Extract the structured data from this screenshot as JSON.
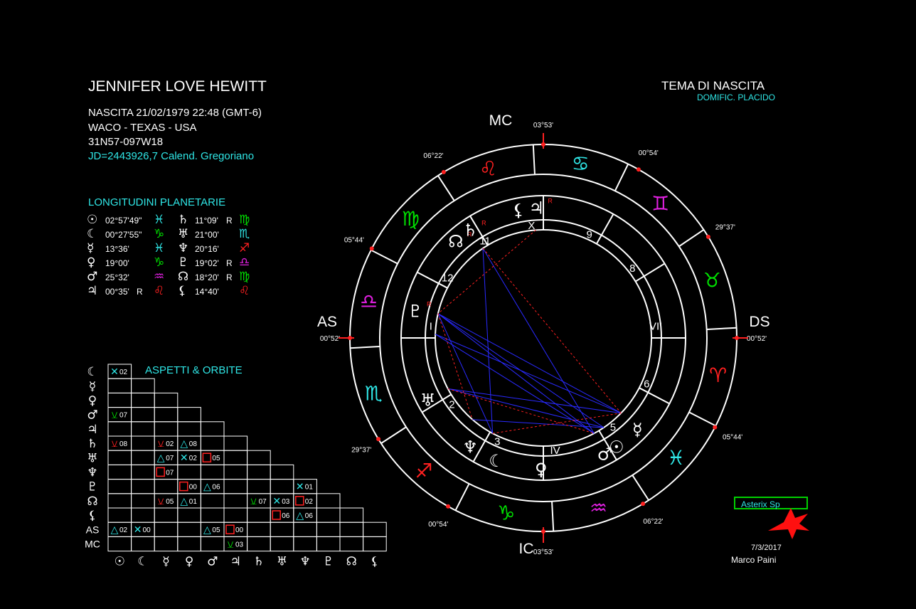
{
  "header": {
    "name": "JENNIFER LOVE HEWITT",
    "birth": "NASCITA 21/02/1979 22:48 (GMT-6)",
    "place": "WACO - TEXAS - USA",
    "coords": "31N57-097W18",
    "jd": "JD=2443926,7  Calend. Gregoriano"
  },
  "chart_title": {
    "title": "TEMA DI NASCITA",
    "subtitle": "DOMIFIC. PLACIDO"
  },
  "longitudes": {
    "title": "LONGITUDINI PLANETARIE",
    "rows": [
      {
        "g1": "☉",
        "v1": "02°57'49\"",
        "r1": "",
        "s1": "♓",
        "c1": "#2fe6e6",
        "g2": "♄",
        "v2": "11°09'",
        "r2": "R",
        "s2": "♍",
        "c2": "#00e000"
      },
      {
        "g1": "☾",
        "v1": "00°27'55\"",
        "r1": "",
        "s1": "♑",
        "c1": "#00e000",
        "g2": "♅",
        "v2": "21°00'",
        "r2": "",
        "s2": "♏",
        "c2": "#2fe6e6"
      },
      {
        "g1": "☿",
        "v1": "13°36'",
        "r1": "",
        "s1": "♓",
        "c1": "#2fe6e6",
        "g2": "♆",
        "v2": "20°16'",
        "r2": "",
        "s2": "♐",
        "c2": "#ff2020"
      },
      {
        "g1": "♀",
        "v1": "19°00'",
        "r1": "",
        "s1": "♑",
        "c1": "#00e000",
        "g2": "♇",
        "v2": "19°02'",
        "r2": "R",
        "s2": "♎",
        "c2": "#e020e0"
      },
      {
        "g1": "♂",
        "v1": "25°32'",
        "r1": "",
        "s1": "♒",
        "c1": "#e020e0",
        "g2": "☊",
        "v2": "18°20'",
        "r2": "R",
        "s2": "♍",
        "c2": "#00e000"
      },
      {
        "g1": "♃",
        "v1": "00°35'",
        "r1": "R",
        "s1": "♌",
        "c1": "#ff2020",
        "g2": "⚸",
        "v2": "14°40'",
        "r2": "",
        "s2": "♌",
        "c2": "#ff2020"
      }
    ]
  },
  "aspects": {
    "title": "ASPETTI  &  ORBITE",
    "row_labels": [
      "☾",
      "☿",
      "♀",
      "♂",
      "♃",
      "♄",
      "♅",
      "♆",
      "♇",
      "☊",
      "⚸",
      "AS",
      "MC"
    ],
    "col_labels": [
      "☉",
      "☾",
      "☿",
      "♀",
      "♂",
      "♃",
      "♄",
      "♅",
      "♆",
      "♇",
      "☊",
      "⚸"
    ],
    "entries": [
      {
        "row": 0,
        "col": 0,
        "sym": "✕",
        "color": "#2fe6e6",
        "orb": "02"
      },
      {
        "row": 3,
        "col": 0,
        "sym": "⚺",
        "color": "#00e000",
        "orb": "07"
      },
      {
        "row": 5,
        "col": 0,
        "sym": "⚺",
        "color": "#ff2020",
        "orb": "08"
      },
      {
        "row": 5,
        "col": 2,
        "sym": "⚺",
        "color": "#ff2020",
        "orb": "02"
      },
      {
        "row": 5,
        "col": 3,
        "sym": "△",
        "color": "#2fe6e6",
        "orb": "08"
      },
      {
        "row": 6,
        "col": 2,
        "sym": "△",
        "color": "#2fe6e6",
        "orb": "07"
      },
      {
        "row": 6,
        "col": 3,
        "sym": "✕",
        "color": "#2fe6e6",
        "orb": "02"
      },
      {
        "row": 6,
        "col": 4,
        "sym": "□",
        "color": "#ff2020",
        "orb": "05"
      },
      {
        "row": 7,
        "col": 2,
        "sym": "□",
        "color": "#ff2020",
        "orb": "07"
      },
      {
        "row": 8,
        "col": 3,
        "sym": "□",
        "color": "#ff2020",
        "orb": "00"
      },
      {
        "row": 8,
        "col": 4,
        "sym": "△",
        "color": "#2fe6e6",
        "orb": "06"
      },
      {
        "row": 8,
        "col": 8,
        "sym": "✕",
        "color": "#2fe6e6",
        "orb": "01"
      },
      {
        "row": 9,
        "col": 2,
        "sym": "⚺",
        "color": "#ff2020",
        "orb": "05"
      },
      {
        "row": 9,
        "col": 3,
        "sym": "△",
        "color": "#2fe6e6",
        "orb": "01"
      },
      {
        "row": 9,
        "col": 6,
        "sym": "⚺",
        "color": "#00e000",
        "orb": "07"
      },
      {
        "row": 9,
        "col": 7,
        "sym": "✕",
        "color": "#2fe6e6",
        "orb": "03"
      },
      {
        "row": 9,
        "col": 8,
        "sym": "□",
        "color": "#ff2020",
        "orb": "02"
      },
      {
        "row": 10,
        "col": 7,
        "sym": "□",
        "color": "#ff2020",
        "orb": "06"
      },
      {
        "row": 10,
        "col": 8,
        "sym": "△",
        "color": "#2fe6e6",
        "orb": "06"
      },
      {
        "row": 11,
        "col": 0,
        "sym": "△",
        "color": "#2fe6e6",
        "orb": "02"
      },
      {
        "row": 11,
        "col": 1,
        "sym": "✕",
        "color": "#2fe6e6",
        "orb": "00"
      },
      {
        "row": 11,
        "col": 4,
        "sym": "△",
        "color": "#2fe6e6",
        "orb": "05"
      },
      {
        "row": 11,
        "col": 5,
        "sym": "□",
        "color": "#ff2020",
        "orb": "00"
      },
      {
        "row": 12,
        "col": 5,
        "sym": "⚺",
        "color": "#00e000",
        "orb": "03"
      }
    ]
  },
  "wheel": {
    "angle_labels": {
      "mc": "MC",
      "ic": "IC",
      "as": "AS",
      "ds": "DS"
    },
    "cusp_degrees": [
      {
        "label": "03°53'",
        "deg": 90
      },
      {
        "label": "00°54'",
        "deg": 60.5
      },
      {
        "label": "29°37'",
        "deg": 31.5
      },
      {
        "label": "00°52'",
        "deg": 0
      },
      {
        "label": "05°44'",
        "deg": -27.5
      },
      {
        "label": "06°22'",
        "deg": -59
      },
      {
        "label": "03°53'",
        "deg": -90
      },
      {
        "label": "00°54'",
        "deg": -119.5
      },
      {
        "label": "29°37'",
        "deg": -148.5
      },
      {
        "label": "00°52'",
        "deg": 180
      },
      {
        "label": "05°44'",
        "deg": 152.5
      },
      {
        "label": "06°22'",
        "deg": 121
      }
    ],
    "sign_boundaries": [
      93,
      64,
      34,
      3,
      -27,
      -57,
      -87,
      -117,
      -147,
      -177,
      153,
      123
    ],
    "signs": [
      {
        "glyph": "♋",
        "deg": 78,
        "color": "#2fe6e6"
      },
      {
        "glyph": "♊",
        "deg": 49,
        "color": "#e020e0"
      },
      {
        "glyph": "♉",
        "deg": 19,
        "color": "#00e000"
      },
      {
        "glyph": "♈",
        "deg": -12,
        "color": "#ff2020"
      },
      {
        "glyph": "♓",
        "deg": -42,
        "color": "#2fe6e6"
      },
      {
        "glyph": "♒",
        "deg": -72,
        "color": "#e020e0"
      },
      {
        "glyph": "♑",
        "deg": -102,
        "color": "#00e000"
      },
      {
        "glyph": "♐",
        "deg": -132,
        "color": "#ff2020"
      },
      {
        "glyph": "♏",
        "deg": -162,
        "color": "#2fe6e6"
      },
      {
        "glyph": "♎",
        "deg": 168,
        "color": "#e020e0"
      },
      {
        "glyph": "♍",
        "deg": 138,
        "color": "#00e000"
      },
      {
        "glyph": "♌",
        "deg": 108,
        "color": "#ff2020"
      }
    ],
    "houses": [
      {
        "label": "X",
        "deg": 96,
        "cusp": 90
      },
      {
        "label": "9",
        "deg": 66,
        "cusp": 60.5
      },
      {
        "label": "8",
        "deg": 38,
        "cusp": 31.5
      },
      {
        "label": "VII",
        "deg": 6,
        "cusp": 0
      },
      {
        "label": "6",
        "deg": -24,
        "cusp": -27.5
      },
      {
        "label": "5",
        "deg": -52,
        "cusp": -59
      },
      {
        "label": "IV",
        "deg": -84,
        "cusp": -90
      },
      {
        "label": "3",
        "deg": -114,
        "cusp": -119.5
      },
      {
        "label": "2",
        "deg": -144,
        "cusp": -148.5
      },
      {
        "label": "I",
        "deg": 174,
        "cusp": 180
      },
      {
        "label": "12",
        "deg": 148,
        "cusp": 152.5
      },
      {
        "label": "11",
        "deg": 121,
        "cusp": 121
      }
    ],
    "planets": [
      {
        "glyph": "⚸",
        "deg": 101,
        "retro": ""
      },
      {
        "glyph": "♃",
        "deg": 93,
        "retro": "R"
      },
      {
        "glyph": "☊",
        "deg": 132,
        "retro": "R"
      },
      {
        "glyph": "♄",
        "deg": 124,
        "retro": "R"
      },
      {
        "glyph": "♇",
        "deg": 168,
        "retro": "R"
      },
      {
        "glyph": "♅",
        "deg": -152,
        "retro": ""
      },
      {
        "glyph": "♆",
        "deg": -124,
        "retro": ""
      },
      {
        "glyph": "☾",
        "deg": -111,
        "retro": ""
      },
      {
        "glyph": "♀",
        "deg": -91,
        "retro": ""
      },
      {
        "glyph": "♂",
        "deg": -62,
        "retro": ""
      },
      {
        "glyph": "☉",
        "deg": -56,
        "retro": ""
      },
      {
        "glyph": "☿",
        "deg": -44,
        "retro": ""
      }
    ],
    "aspect_lines": [
      {
        "a": 167,
        "b": -44,
        "color": "#2a2aff",
        "style": "solid"
      },
      {
        "a": 167,
        "b": -56,
        "color": "#2a2aff",
        "style": "solid"
      },
      {
        "a": 167,
        "b": -62,
        "color": "#2a2aff",
        "style": "solid"
      },
      {
        "a": 167,
        "b": -118,
        "color": "#2a2aff",
        "style": "solid"
      },
      {
        "a": 124,
        "b": -118,
        "color": "#2a2aff",
        "style": "solid"
      },
      {
        "a": 124,
        "b": -62,
        "color": "#2a2aff",
        "style": "solid"
      },
      {
        "a": -152,
        "b": -44,
        "color": "#2a2aff",
        "style": "solid"
      },
      {
        "a": -152,
        "b": -56,
        "color": "#2a2aff",
        "style": "solid"
      },
      {
        "a": -131,
        "b": -56,
        "color": "#2a2aff",
        "style": "solid"
      },
      {
        "a": 178,
        "b": -62,
        "color": "#2a2aff",
        "style": "solid"
      },
      {
        "a": 178,
        "b": -44,
        "color": "#2a2aff",
        "style": "solid"
      },
      {
        "a": 94,
        "b": 167,
        "color": "#ff2020",
        "style": "dashed"
      },
      {
        "a": 124,
        "b": -44,
        "color": "#ff2020",
        "style": "dashed"
      },
      {
        "a": 167,
        "b": -131,
        "color": "#ff2020",
        "style": "dashed"
      },
      {
        "a": -152,
        "b": -62,
        "color": "#ff2020",
        "style": "dashed"
      },
      {
        "a": -118,
        "b": -44,
        "color": "#ff2020",
        "style": "dashed"
      }
    ]
  },
  "footer": {
    "tool": "Asterix Sp",
    "date": "7/3/2017",
    "author": "Marco Paini"
  }
}
